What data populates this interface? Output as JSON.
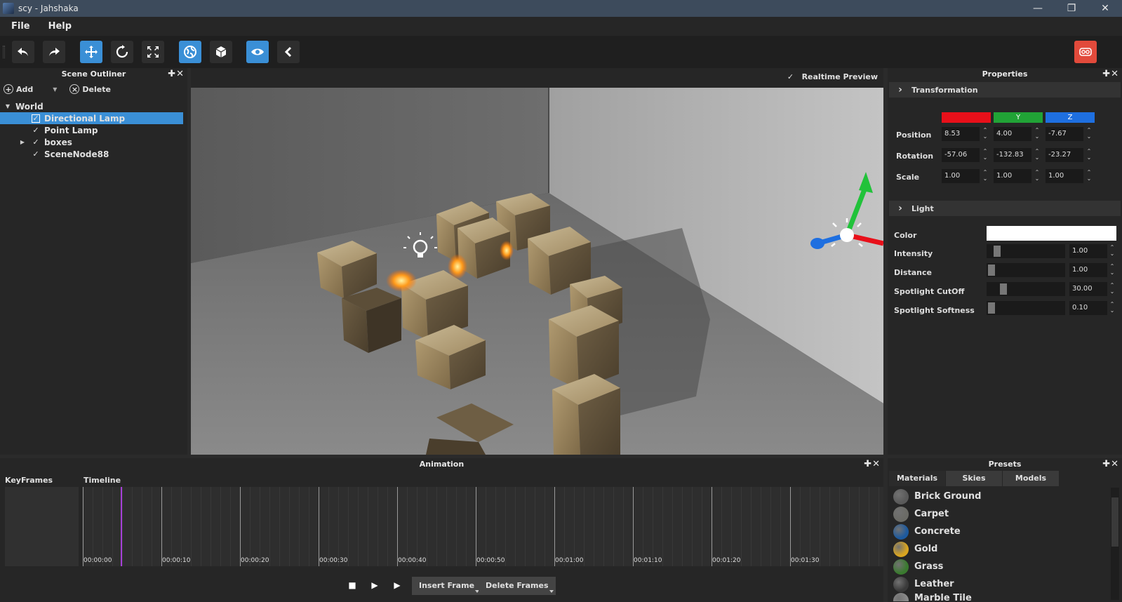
{
  "window": {
    "title": "scy - Jahshaka",
    "minimize": "—",
    "maximize": "❐",
    "close": "✕"
  },
  "menu": {
    "items": [
      "File",
      "Help"
    ]
  },
  "toolbar": {
    "buttons": [
      "undo-icon",
      "redo-icon",
      "move-icon",
      "rotate-icon",
      "scale-icon",
      "globe-icon",
      "cube-icon",
      "eye-icon",
      "chevron-left-icon",
      "vr-icon"
    ],
    "accent": "#3a8fd6",
    "vr_color": "#e24a3b"
  },
  "outliner": {
    "title": "Scene Outliner",
    "controls": "✚✕",
    "add_label": "Add",
    "delete_label": "Delete",
    "root": "World",
    "items": [
      {
        "label": "Directional Lamp",
        "selected": true
      },
      {
        "label": "Point Lamp",
        "selected": false
      },
      {
        "label": "boxes",
        "selected": false,
        "has_children": true
      },
      {
        "label": "SceneNode88",
        "selected": false
      }
    ],
    "check": "✓"
  },
  "viewport": {
    "realtime_label": "Realtime Preview",
    "check": "✓"
  },
  "properties": {
    "title": "Properties",
    "controls": "✚✕",
    "transformation": {
      "label": "Transformation",
      "axes": [
        "",
        "Y",
        "Z"
      ],
      "axis_colors": [
        "#e8101a",
        "#21a336",
        "#1e6fe0"
      ],
      "rows": [
        {
          "label": "Position",
          "values": [
            "8.53",
            "4.00",
            "-7.67"
          ]
        },
        {
          "label": "Rotation",
          "values": [
            "-57.06",
            "-132.83",
            "-23.27"
          ]
        },
        {
          "label": "Scale",
          "values": [
            "1.00",
            "1.00",
            "1.00"
          ]
        }
      ]
    },
    "light": {
      "label": "Light",
      "color_label": "Color",
      "color_value": "#ffffff",
      "sliders": [
        {
          "label": "Intensity",
          "value": "1.00",
          "fraction": 0.08
        },
        {
          "label": "Distance",
          "value": "1.00",
          "fraction": 0.0
        },
        {
          "label": "Spotlight CutOff",
          "value": "30.00",
          "fraction": 0.17
        },
        {
          "label": "Spotlight Softness",
          "value": "0.10",
          "fraction": 0.0
        }
      ]
    }
  },
  "animation": {
    "title": "Animation",
    "controls": "✚✕",
    "keyframes_label": "KeyFrames",
    "timeline_label": "Timeline",
    "ticks": [
      "00:00:00",
      "00:00:10",
      "00:00:20",
      "00:00:30",
      "00:00:40",
      "00:00:50",
      "00:01:00",
      "00:01:10",
      "00:01:20",
      "00:01:30"
    ],
    "insert_label": "Insert Frame",
    "delete_label": "Delete Frames",
    "playhead_color": "#a640d8"
  },
  "presets": {
    "title": "Presets",
    "controls": "✚✕",
    "tabs": [
      "Materials",
      "Skies",
      "Models"
    ],
    "items": [
      {
        "label": "Brick Ground",
        "color": "#5a5a5a"
      },
      {
        "label": "Carpet",
        "color": "#6b6b66"
      },
      {
        "label": "Concrete",
        "color": "#1d5a9e"
      },
      {
        "label": "Gold",
        "color": "#d9a520"
      },
      {
        "label": "Grass",
        "color": "#3a7a2f"
      },
      {
        "label": "Leather",
        "color": "#3a3a3a"
      },
      {
        "label": "Marble Tile",
        "color": "#8a8a8a"
      }
    ]
  }
}
